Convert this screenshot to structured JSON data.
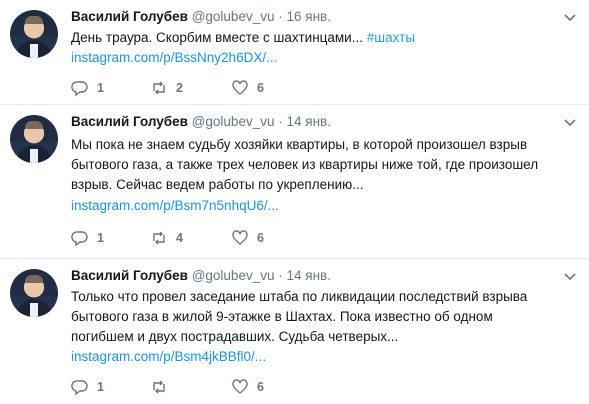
{
  "tweets": [
    {
      "name": "Василий Голубев",
      "handle": "@golubev_vu",
      "dot": "·",
      "time": "16 янв.",
      "text_lines": [
        "День траура. Скорбим вместе с шахтинцами..."
      ],
      "hashtag": "#шахты",
      "link": "instagram.com/p/BssNny2h6DX/...",
      "replies": "1",
      "retweets": "2",
      "likes": "6"
    },
    {
      "name": "Василий Голубев",
      "handle": "@golubev_vu",
      "dot": "·",
      "time": "14 янв.",
      "text_lines": [
        "Мы пока не знаем судьбу хозяйки квартиры, в которой произошел взрыв",
        "бытового газа, а также трех человек из квартиры ниже той, где произошел",
        "взрыв. Сейчас ведем работы по укреплению..."
      ],
      "link": "instagram.com/p/Bsm7n5nhqU6/...",
      "replies": "1",
      "retweets": "4",
      "likes": "6"
    },
    {
      "name": "Василий Голубев",
      "handle": "@golubev_vu",
      "dot": "·",
      "time": "14 янв.",
      "text_lines": [
        "Только что провел заседание штаба по ликвидации последствий взрыва",
        "бытового газа в жилой 9-этажке в Шахтах. Пока известно об одном",
        "погибшем и двух пострадавших. Судьба четверых..."
      ],
      "link": "instagram.com/p/Bsm4jkBBfl0/...",
      "replies": "1",
      "retweets": "",
      "likes": "6"
    }
  ]
}
